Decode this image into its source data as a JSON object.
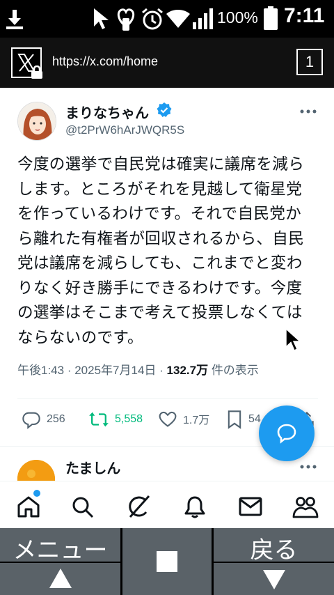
{
  "status_bar": {
    "battery_percent": "100%",
    "time": "7:11"
  },
  "browser": {
    "url": "https://x.com/home",
    "tab_count": "1"
  },
  "tweet": {
    "author_name": "まりなちゃん",
    "author_handle": "@t2PrW6hArJWQR5S",
    "lines": [
      "今度の選挙で自民党は確実に議席を減ら",
      "します。ところがそれを見越して衛星党",
      "を作っているわけです。それで自民党か",
      "ら離れた有権者が回収されるから、自民",
      "党は議席を減らしても、これまでと変わ",
      "りなく好き勝手にできるわけです。今度",
      "の選挙はそこまで考えて投票しなくては",
      "ならないのです。"
    ],
    "time": "午後1:43",
    "date": "2025年7月14日",
    "views_count": "132.7万",
    "views_label": "件の表示",
    "replies": "256",
    "retweets": "5,558",
    "likes": "1.7万",
    "bookmarks": "54"
  },
  "next_tweet": {
    "author_name": "たましん"
  },
  "colors": {
    "accent": "#1d9bf0",
    "retweet_green": "#00ba7c",
    "muted": "#536471"
  },
  "icons": [
    "download-icon",
    "cursor-icon",
    "heart-notification-icon",
    "alarm-icon",
    "wifi-icon",
    "signal-icon",
    "battery-icon",
    "x-logo-icon",
    "lock-icon",
    "verified-icon",
    "more-icon",
    "reply-icon",
    "retweet-icon",
    "like-icon",
    "bookmark-icon",
    "share-icon",
    "compose-message-icon",
    "home-icon",
    "search-icon",
    "grok-icon",
    "bell-icon",
    "mail-icon",
    "communities-icon",
    "up-arrow-icon",
    "stop-icon",
    "down-arrow-icon"
  ],
  "system_buttons": {
    "menu_label": "メニュー",
    "back_label": "戻る"
  }
}
